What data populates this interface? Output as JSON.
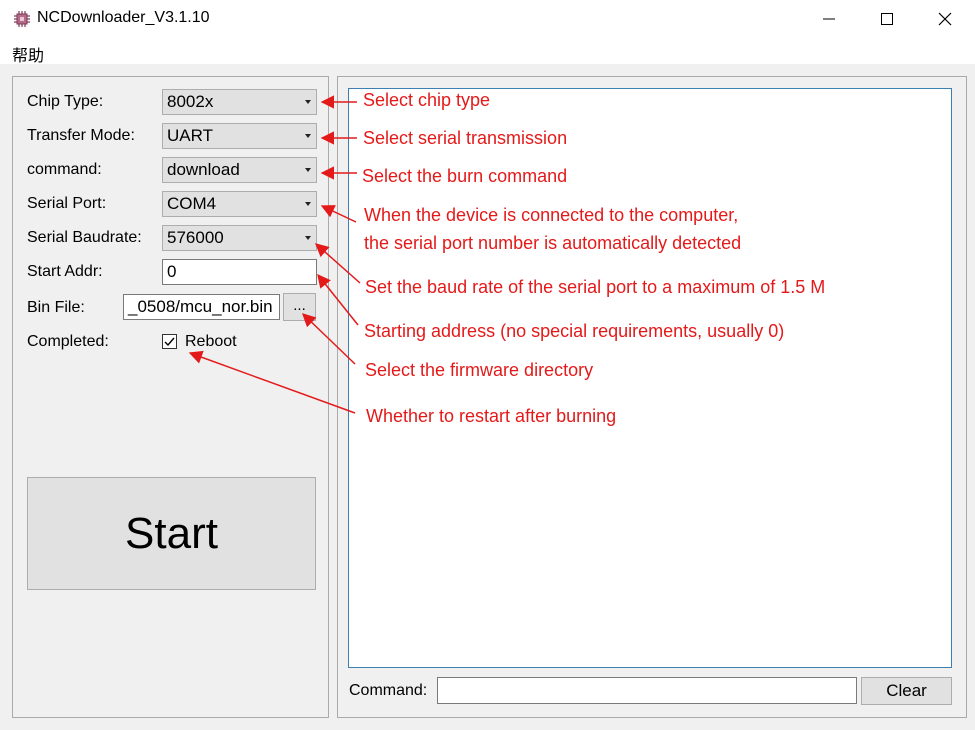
{
  "window": {
    "title": "NCDownloader_V3.1.10",
    "controls": {
      "minimize": "—",
      "maximize": "☐",
      "close": "✕"
    }
  },
  "menu": {
    "help": "帮助"
  },
  "form": {
    "chip_type": {
      "label": "Chip Type:",
      "value": "8002x"
    },
    "transfer_mode": {
      "label": "Transfer Mode:",
      "value": "UART"
    },
    "command": {
      "label": "command:",
      "value": "download"
    },
    "serial_port": {
      "label": "Serial Port:",
      "value": "COM4"
    },
    "baudrate": {
      "label": "Serial Baudrate:",
      "value": "576000"
    },
    "start_addr": {
      "label": "Start Addr:",
      "value": "0"
    },
    "bin_file": {
      "label": "Bin File:",
      "value": "_0508/mcu_nor.bin",
      "browse": "..."
    },
    "completed": {
      "label": "Completed:",
      "checkbox_label": "Reboot",
      "checked": true
    }
  },
  "start_button": "Start",
  "log": {
    "command_label": "Command:",
    "command_value": "",
    "clear_button": "Clear"
  },
  "annotations": {
    "color": "#e41a1a",
    "chip_type": "Select chip type",
    "transfer_mode": "Select serial transmission",
    "command": "Select the burn command",
    "serial_port_1": "When the device is connected to the computer,",
    "serial_port_2": "the serial port number is automatically detected",
    "baudrate": "Set the baud rate of the serial port to a maximum of 1.5 M",
    "start_addr": "Starting address (no special requirements, usually 0)",
    "bin_file": "Select the firmware directory",
    "reboot": "Whether to restart after burning"
  }
}
